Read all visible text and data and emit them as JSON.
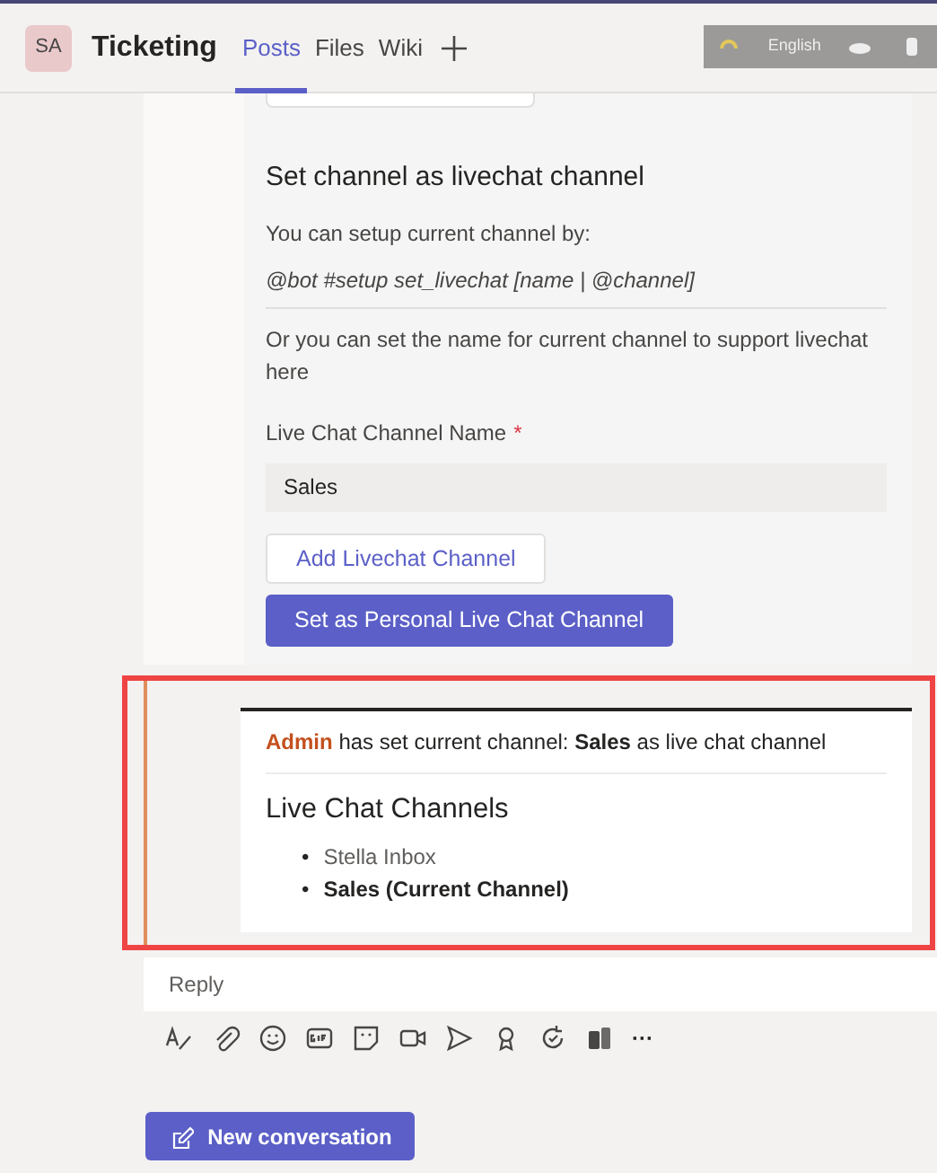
{
  "header": {
    "avatar": "SA",
    "title": "Ticketing",
    "tabs": [
      {
        "label": "Posts",
        "selected": true
      },
      {
        "label": "Files",
        "selected": false
      },
      {
        "label": "Wiki",
        "selected": false
      }
    ],
    "language_bar": {
      "label": "English"
    }
  },
  "setup_card": {
    "heading": "Set channel as livechat channel",
    "intro": "You can setup current channel by:",
    "command": "@bot #setup set_livechat [name | @channel]",
    "alt_text": "Or you can set the name for current channel to support livechat here",
    "field": {
      "label": "Live Chat Channel Name",
      "required": true,
      "required_mark": "*",
      "value": "Sales"
    },
    "buttons": [
      {
        "label": "Add Livechat Channel",
        "kind": "secondary"
      },
      {
        "label": "Set as Personal Live Chat Channel",
        "kind": "primary"
      }
    ]
  },
  "notice_card": {
    "author": "Admin",
    "message": "has set current channel: **Sales** as live chat channel",
    "heading": "Live Chat Channels",
    "channels": [
      {
        "marker": "•",
        "label": "Stella Inbox",
        "current": false
      },
      {
        "marker": "•",
        "label": "Sales (Current Channel)",
        "current": true
      }
    ]
  },
  "reply": {
    "placeholder": "Reply"
  },
  "toolbar": {
    "more": "···"
  },
  "new_conversation": {
    "label": "New conversation"
  }
}
